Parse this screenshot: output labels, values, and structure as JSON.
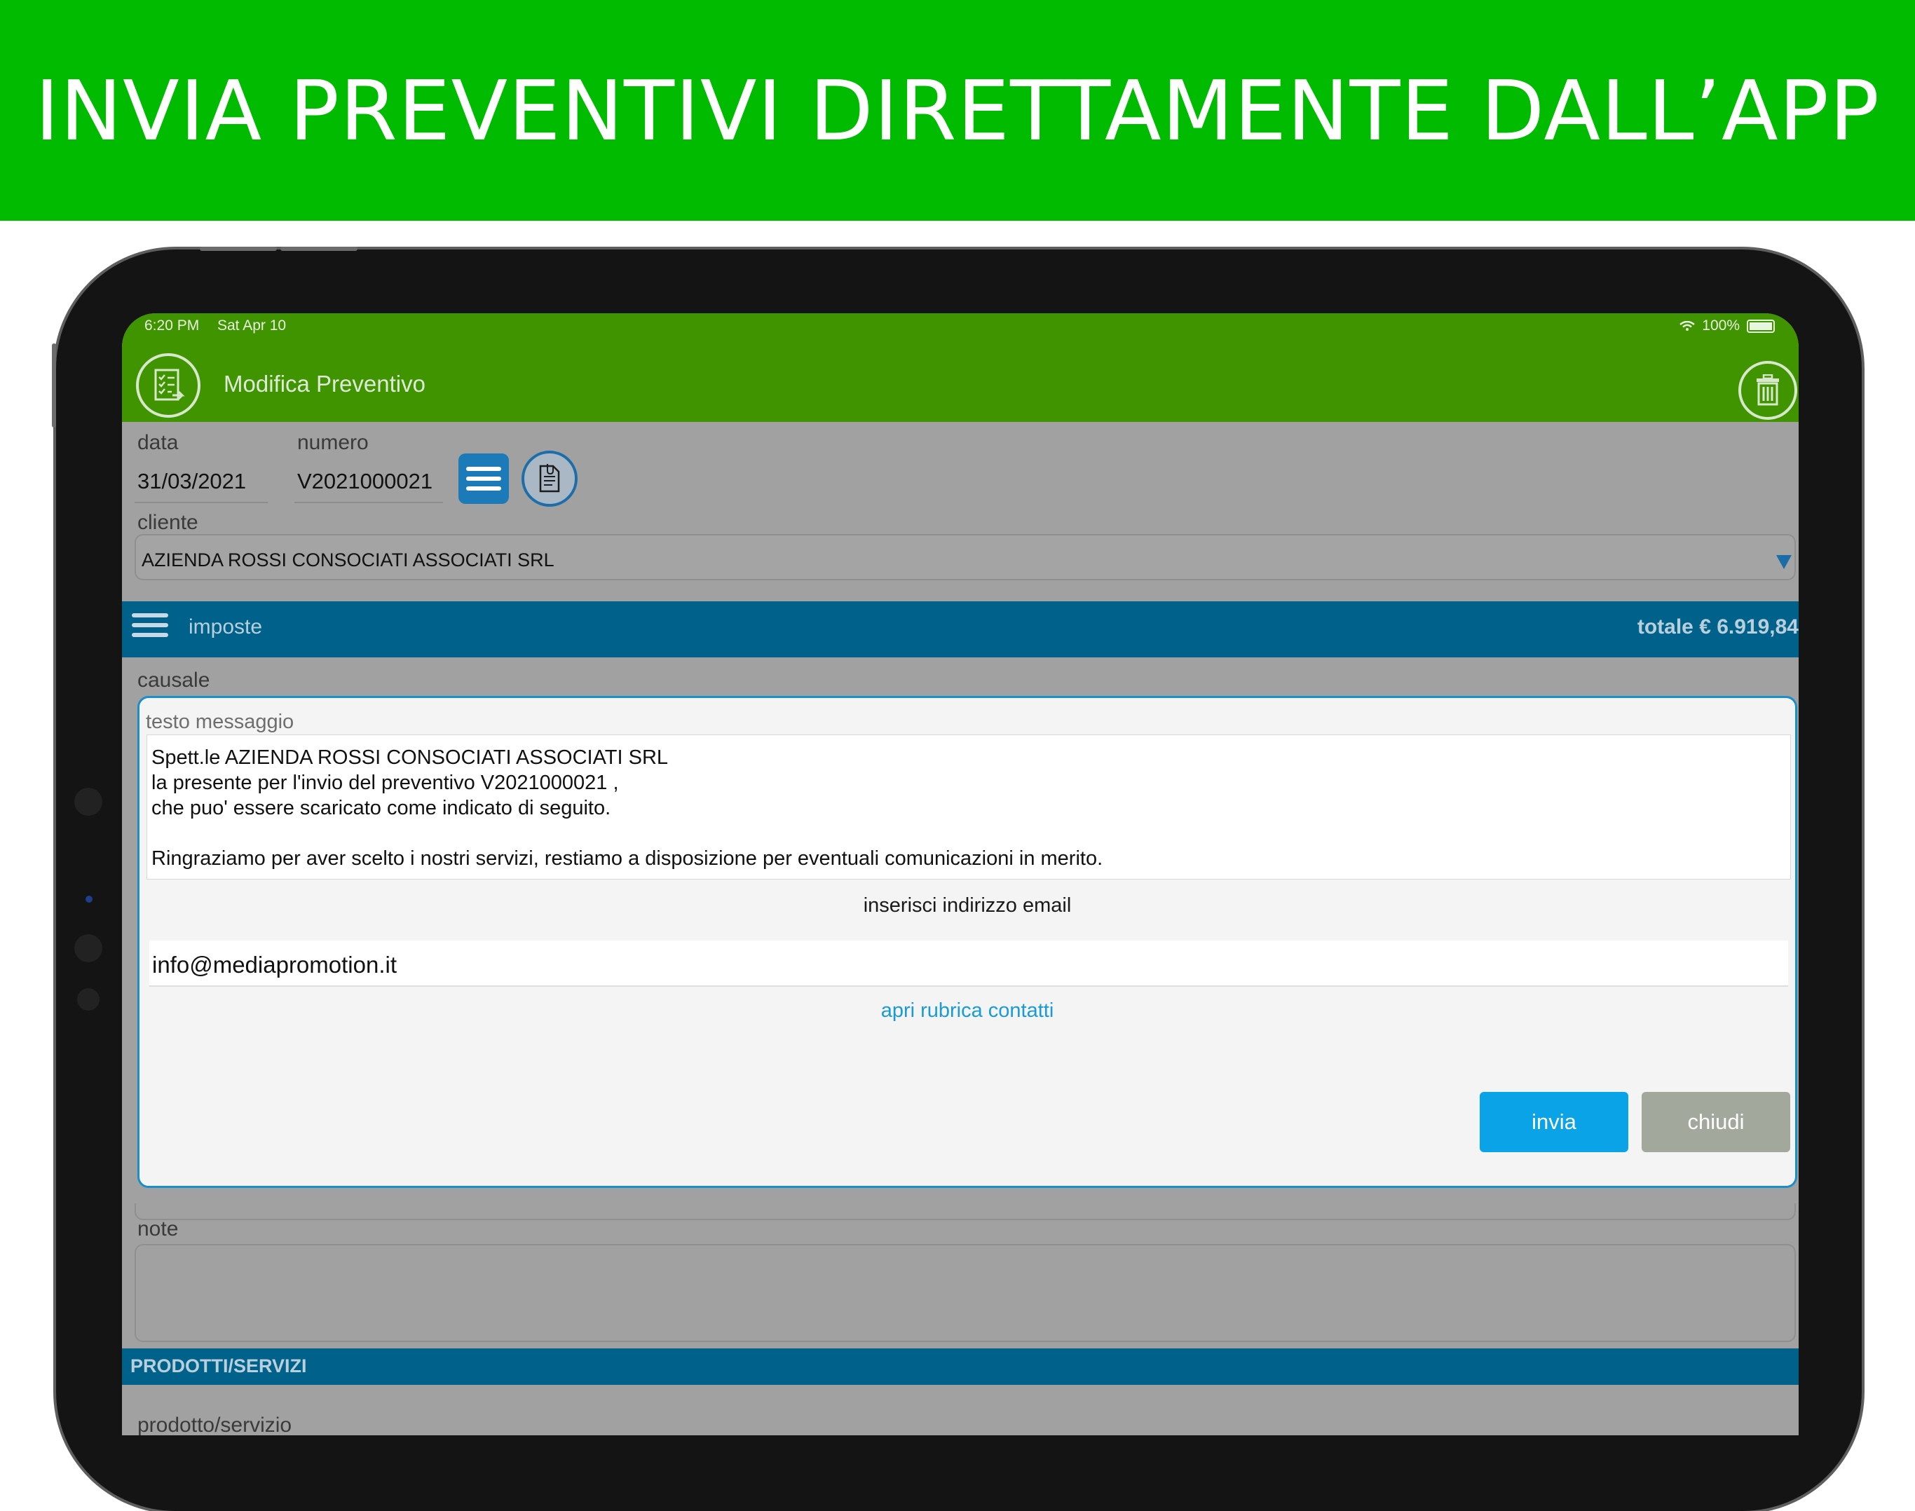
{
  "banner": {
    "title": "INVIA PREVENTIVI DIRETTAMENTE DALL’APP"
  },
  "status_bar": {
    "time": "6:20 PM",
    "date": "Sat Apr 10",
    "battery": "100%"
  },
  "header": {
    "title": "Modifica Preventivo"
  },
  "form": {
    "data_label": "data",
    "data_value": "31/03/2021",
    "numero_label": "numero",
    "numero_value": "V2021000021",
    "cliente_label": "cliente",
    "cliente_value": "AZIENDA ROSSI CONSOCIATI ASSOCIATI SRL",
    "imposte_label": "imposte",
    "totale": "totale € 6.919,84",
    "causale_label": "causale",
    "note_label": "note",
    "prodotti_header": "PRODOTTI/SERVIZI",
    "prodotto_label": "prodotto/servizio"
  },
  "modal": {
    "message_label": "testo messaggio",
    "message_lines": [
      "Spett.le AZIENDA ROSSI CONSOCIATI ASSOCIATI SRL",
      "la presente per l'invio del preventivo V2021000021 ,",
      "che puo' essere scaricato come indicato di seguito.",
      "",
      "Ringraziamo per aver scelto i nostri servizi, restiamo a disposizione per eventuali comunicazioni in merito."
    ],
    "email_prompt": "inserisci indirizzo email",
    "email_value": "info@mediapromotion.it",
    "contacts_link": "apri rubrica contatti",
    "send_label": "invia",
    "close_label": "chiudi"
  },
  "colors": {
    "banner": "#00bb00",
    "header": "#3f9400",
    "section_bar": "#00628b",
    "send_button": "#0aa3e8",
    "close_button": "#a2a89c",
    "link": "#1a9ad8"
  }
}
